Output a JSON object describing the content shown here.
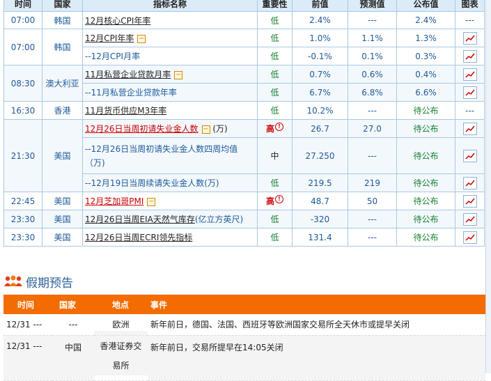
{
  "headers": {
    "time": "时间",
    "country": "国家",
    "indicator": "指标名称",
    "importance": "重要性",
    "previous": "前值",
    "forecast": "预测值",
    "actual": "公布值",
    "chart": "图表"
  },
  "rows": [
    {
      "time": "07:00",
      "country": "韩国",
      "name": "12月核心CPI年率",
      "importance": "低",
      "previous": "2.4%",
      "forecast": "---",
      "actual": "2.4%",
      "chart": "---"
    },
    {
      "time": "07:00",
      "country": "韩国",
      "name": "12月CPI年率",
      "importance": "低",
      "previous": "1.0%",
      "forecast": "1.1%",
      "actual": "1.3%"
    },
    {
      "name": "--12月CPI月率",
      "importance": "低",
      "previous": "-0.1%",
      "forecast": "0.1%",
      "actual": "0.3%"
    },
    {
      "time": "08:30",
      "country": "澳大利亚",
      "name": "11月私营企业贷款月率",
      "importance": "低",
      "previous": "0.7%",
      "forecast": "0.6%",
      "actual": "0.4%"
    },
    {
      "name": "--11月私营企业贷款年率",
      "importance": "低",
      "previous": "6.7%",
      "forecast": "6.8%",
      "actual": "6.6%"
    },
    {
      "time": "16:30",
      "country": "香港",
      "name": "11月货币供应M3年率",
      "importance": "低",
      "previous": "10.2%",
      "forecast": "---",
      "actual": "待公布",
      "chart": "---"
    },
    {
      "time": "21:30",
      "country": "美国",
      "name": "12月26日当周初请失业金人数",
      "name_suffix": "(万)",
      "importance": "高",
      "previous": "26.7",
      "forecast": "27.0",
      "actual": "待公布"
    },
    {
      "name": "--12月26日当周初请失业金人数四周均值（万)",
      "importance": "中",
      "previous": "27.250",
      "forecast": "---",
      "actual": "待公布"
    },
    {
      "name": "--12月19日当周续请失业金人数(万)",
      "importance": "低",
      "previous": "219.5",
      "forecast": "219",
      "actual": "待公布"
    },
    {
      "time": "22:45",
      "country": "美国",
      "name": "12月芝加哥PMI",
      "importance": "高",
      "previous": "48.7",
      "forecast": "50",
      "actual": "待公布"
    },
    {
      "time": "23:30",
      "country": "美国",
      "name": "12月26日当周EIA天然气库存",
      "name_suffix": "(亿立方英尺)",
      "importance": "低",
      "previous": "-320",
      "forecast": "---",
      "actual": "待公布"
    },
    {
      "time": "23:30",
      "country": "美国",
      "name": "12月26日当周ECRI领先指标",
      "importance": "低",
      "previous": "131.4",
      "forecast": "---",
      "actual": "待公布"
    }
  ],
  "holiday": {
    "title": "假期预告",
    "headers": {
      "time": "时间",
      "country": "国家",
      "place": "地点",
      "event": "事件"
    },
    "rows": [
      {
        "time": "12/31 ---",
        "country": "---",
        "place": "欧洲",
        "event": "新年前日，德国、法国、西班牙等欧洲国家交易所全天休市或提早关闭"
      },
      {
        "time": "12/31 ---",
        "country": "中国",
        "place": "香港证券交易所",
        "event": "新年前日，交易所提早在14:05关闭"
      }
    ]
  },
  "colors": {
    "accent_orange": "#f36c00",
    "header_blue": "#dcebf8",
    "low_green": "#15802f",
    "high_red": "#cc0000"
  },
  "icons": {
    "chart": "chart-icon",
    "expand": "expand-icon",
    "alert": "alert-icon",
    "people": "people-icon"
  }
}
